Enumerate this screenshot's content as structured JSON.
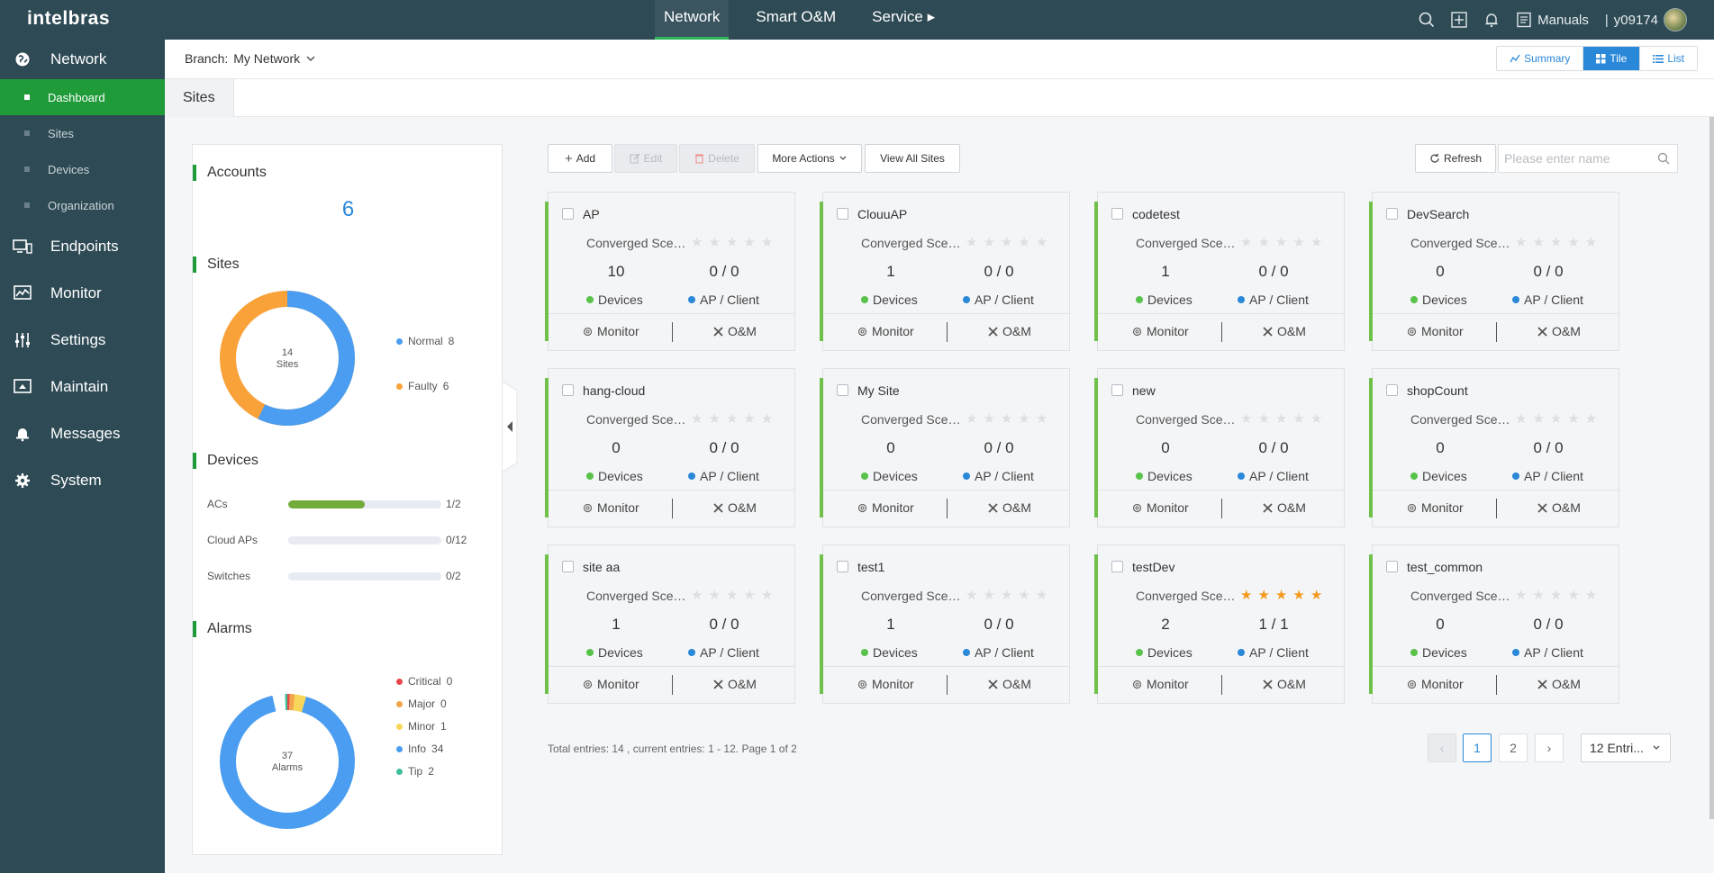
{
  "app": {
    "logo": "intelbras"
  },
  "topnav": [
    {
      "label": "Network",
      "active": true
    },
    {
      "label": "Smart O&M",
      "active": false
    },
    {
      "label": "Service ▸",
      "active": false
    }
  ],
  "topright": {
    "manuals": "Manuals",
    "user": "y09174"
  },
  "sidebar": {
    "sections": [
      {
        "label": "Network",
        "icon": "globe-icon"
      },
      {
        "label": "Endpoints",
        "icon": "monitor-devices-icon"
      },
      {
        "label": "Monitor",
        "icon": "chart-screen-icon"
      },
      {
        "label": "Settings",
        "icon": "sliders-icon"
      },
      {
        "label": "Maintain",
        "icon": "toolbox-screen-icon"
      },
      {
        "label": "Messages",
        "icon": "bell-icon"
      },
      {
        "label": "System",
        "icon": "gear-icon"
      }
    ],
    "subitems": [
      {
        "label": "Dashboard",
        "active": true
      },
      {
        "label": "Sites",
        "active": false
      },
      {
        "label": "Devices",
        "active": false
      },
      {
        "label": "Organization",
        "active": false
      }
    ]
  },
  "branch": {
    "label": "Branch:",
    "value": "My Network"
  },
  "view_toggle": [
    {
      "label": "Summary",
      "active": false
    },
    {
      "label": "Tile",
      "active": true
    },
    {
      "label": "List",
      "active": false
    }
  ],
  "tab": "Sites",
  "stats": {
    "accounts": {
      "title": "Accounts",
      "count": "6"
    },
    "sites": {
      "title": "Sites",
      "total": "14",
      "unit": "Sites",
      "normal": {
        "label": "Normal",
        "value": "8",
        "color": "#4a9df0"
      },
      "faulty": {
        "label": "Faulty",
        "value": "6",
        "color": "#f9a23a"
      }
    },
    "devices": {
      "title": "Devices",
      "rows": [
        {
          "label": "ACs",
          "online": 1,
          "total": 2,
          "text": "1/2"
        },
        {
          "label": "Cloud APs",
          "online": 0,
          "total": 12,
          "text": "0/12"
        },
        {
          "label": "Switches",
          "online": 0,
          "total": 2,
          "text": "0/2"
        }
      ]
    },
    "alarms": {
      "title": "Alarms",
      "total": "37",
      "unit": "Alarms",
      "legend": [
        {
          "label": "Critical",
          "value": "0",
          "count": 0,
          "color": "#e8484a"
        },
        {
          "label": "Major",
          "value": "0",
          "count": 0,
          "color": "#f2a54a"
        },
        {
          "label": "Minor",
          "value": "1",
          "count": 1,
          "color": "#f8d659"
        },
        {
          "label": "Info",
          "value": "34",
          "count": 34,
          "color": "#4a9df0"
        },
        {
          "label": "Tip",
          "value": "2",
          "count": 2,
          "color": "#3dbf9a"
        }
      ]
    }
  },
  "toolbar": {
    "add": "Add",
    "edit": "Edit",
    "delete": "Delete",
    "more": "More Actions",
    "view_all": "View All Sites",
    "refresh": "Refresh",
    "search_placeholder": "Please enter name"
  },
  "card_labels": {
    "scene": "Converged Scenario",
    "devices": "Devices",
    "ap_client": "AP / Client",
    "monitor": "Monitor",
    "om": "O&M"
  },
  "sites": [
    {
      "name": "AP",
      "devices": "10",
      "ap_client": "0 / 0",
      "stars": 0
    },
    {
      "name": "ClouuAP",
      "devices": "1",
      "ap_client": "0 / 0",
      "stars": 0
    },
    {
      "name": "codetest",
      "devices": "1",
      "ap_client": "0 / 0",
      "stars": 0
    },
    {
      "name": "DevSearch",
      "devices": "0",
      "ap_client": "0 / 0",
      "stars": 0
    },
    {
      "name": "hang-cloud",
      "devices": "0",
      "ap_client": "0 / 0",
      "stars": 0
    },
    {
      "name": "My Site",
      "devices": "0",
      "ap_client": "0 / 0",
      "stars": 0
    },
    {
      "name": "new",
      "devices": "0",
      "ap_client": "0 / 0",
      "stars": 0
    },
    {
      "name": "shopCount",
      "devices": "0",
      "ap_client": "0 / 0",
      "stars": 0
    },
    {
      "name": "site aa",
      "devices": "1",
      "ap_client": "0 / 0",
      "stars": 0
    },
    {
      "name": "test1",
      "devices": "1",
      "ap_client": "0 / 0",
      "stars": 0
    },
    {
      "name": "testDev",
      "devices": "2",
      "ap_client": "1 / 1",
      "stars": 5
    },
    {
      "name": "test_common",
      "devices": "0",
      "ap_client": "0 / 0",
      "stars": 0
    }
  ],
  "footer": {
    "totals": "Total entries: 14 , current entries: 1 - 12. Page 1 of 2",
    "pages": [
      "1",
      "2"
    ],
    "current_page": "1",
    "entries_select": "12 Entri..."
  },
  "colors": {
    "brand_dark": "#2e4a55",
    "accent_green": "#1f9b3a",
    "primary_blue": "#2a88d8",
    "star": "#f39a1e"
  }
}
